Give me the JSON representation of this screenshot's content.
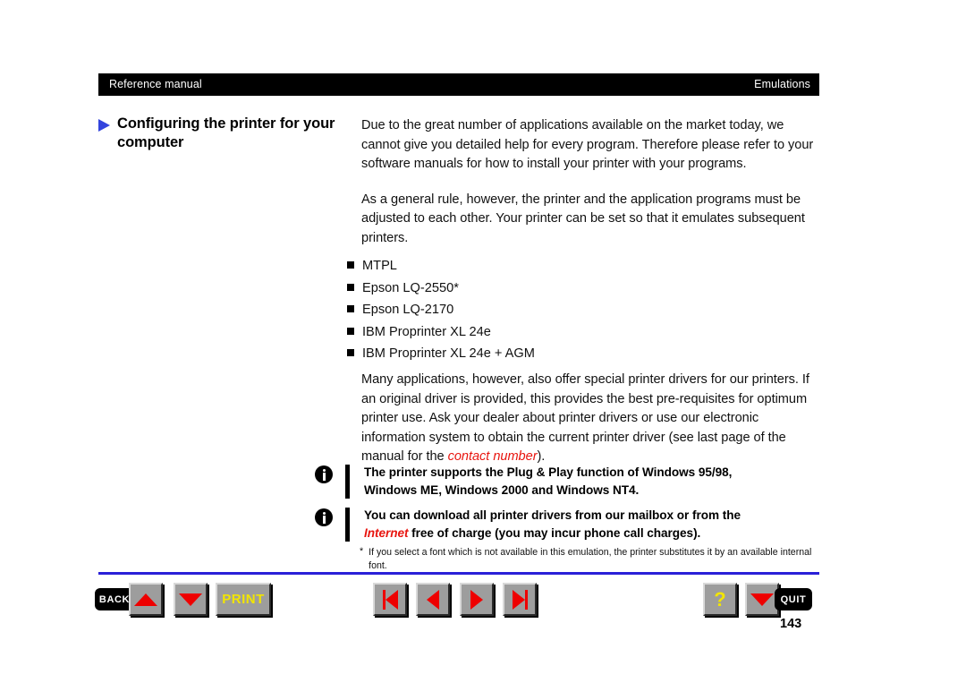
{
  "header": {
    "left_title": "Reference manual",
    "right_title": "Emulations"
  },
  "heading": {
    "marker_icon": "blue-triangle-right-icon",
    "text": "Configuring the printer for your computer"
  },
  "body": {
    "paragraph_1": "Due to the great number of applications available on the market today, we cannot give you detailed help for every program. Therefore please refer to your software manuals for how to install your printer with your programs.",
    "paragraph_2": "As a general rule, however, the printer and the application programs must be adjusted to each other. Your printer can be set so that it emulates subsequent printers.",
    "paragraph_3_part1": "Many applications, however, also offer special printer drivers for our printers. If an original driver is provided, this provides the best pre-requisites for optimum printer use. Ask your dealer about printer drivers or use our electronic information system to obtain the current printer driver (see last page of the manual for the ",
    "paragraph_3_highlight": "contact number",
    "paragraph_3_part2": ")."
  },
  "emulation_list": [
    "MTPL",
    "Epson LQ-2550*",
    "Epson LQ-2170",
    "IBM Proprinter XL 24e",
    "IBM Proprinter XL 24e + AGM"
  ],
  "notes": [
    {
      "icon": "info-icon",
      "line1": "The printer supports the Plug & Play function of Windows 95/98,",
      "line2": "Windows ME, Windows 2000 and Windows NT4.",
      "highlight": "",
      "after_highlight": ""
    },
    {
      "icon": "info-icon",
      "line1": "You can download all printer drivers from our mailbox or from the",
      "line2": "",
      "highlight": "Internet",
      "after_highlight": " free of charge (you may incur phone call charges)."
    }
  ],
  "footnote": {
    "marker": "*",
    "text": "If you select a font which is not available in this emulation, the printer substitutes it by an available internal font."
  },
  "navigation": {
    "back_label": "BACK",
    "up_icon": "triangle-up-icon",
    "down_icon": "triangle-down-icon",
    "print_label": "PRINT",
    "first_icon": "skip-to-first-icon",
    "prev_icon": "triangle-left-icon",
    "next_icon": "triangle-right-icon",
    "last_icon": "skip-to-last-icon",
    "help_label": "?",
    "quit_down_icon": "triangle-down-icon",
    "quit_label": "QUIT",
    "page_number": "143"
  },
  "colors": {
    "header_bar": "#000000",
    "heading_marker": "#3344dd",
    "rule": "#2a20d8",
    "highlight_red": "#e8150f",
    "button_face": "#9d9d9d",
    "glyph_red": "#ee0000",
    "label_yellow": "#f2e500"
  }
}
